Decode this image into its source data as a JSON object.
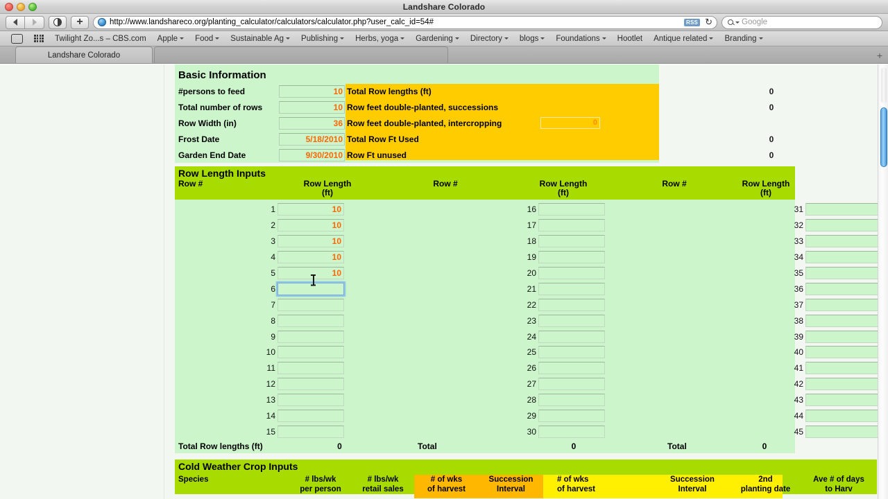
{
  "window": {
    "title": "Landshare Colorado"
  },
  "toolbar": {
    "back_label": "Back",
    "forward_label": "Forward",
    "share_label": "Share",
    "add_label": "+",
    "url": "http://www.landshareco.org/planting_calculator/calculators/calculator.php?user_calc_id=54#",
    "rss_label": "RSS",
    "reload_label": "↻",
    "search_placeholder": "Google"
  },
  "bookmarks": [
    {
      "label": "Twilight Zo...s – CBS.com",
      "menu": false
    },
    {
      "label": "Apple",
      "menu": true
    },
    {
      "label": "Food",
      "menu": true
    },
    {
      "label": "Sustainable Ag",
      "menu": true
    },
    {
      "label": "Publishing",
      "menu": true
    },
    {
      "label": "Herbs, yoga",
      "menu": true
    },
    {
      "label": "Gardening",
      "menu": true
    },
    {
      "label": "Directory",
      "menu": true
    },
    {
      "label": "blogs",
      "menu": true
    },
    {
      "label": "Foundations",
      "menu": true
    },
    {
      "label": "Hootlet",
      "menu": false
    },
    {
      "label": "Antique related",
      "menu": true
    },
    {
      "label": "Branding",
      "menu": true
    }
  ],
  "tabs": {
    "active_label": "Landshare Colorado",
    "inactive_label": "",
    "new_tab_label": "+"
  },
  "basic_information": {
    "title": "Basic Information",
    "fields": [
      {
        "label": "#persons to feed",
        "value": "10"
      },
      {
        "label": "Total number of rows",
        "value": "10"
      },
      {
        "label": "Row Width (in)",
        "value": "36"
      },
      {
        "label": "Frost Date",
        "value": "5/18/2010"
      },
      {
        "label": "Garden End Date",
        "value": "9/30/2010"
      }
    ],
    "summary": [
      {
        "label": "Total Row lengths (ft)",
        "value": "0",
        "input": false
      },
      {
        "label": "Row feet double-planted, successions",
        "value": "0",
        "input": false
      },
      {
        "label": "Row feet double-planted, intercropping",
        "value": "0",
        "input": true
      },
      {
        "label": "Total Row Ft Used",
        "value": "0",
        "input": false
      },
      {
        "label": "Row Ft unused",
        "value": "0",
        "input": false
      }
    ]
  },
  "row_length_inputs": {
    "title": "Row Length Inputs",
    "columns": [
      {
        "header": "Row #",
        "sub": ""
      },
      {
        "header": "Row Length",
        "sub": "(ft)"
      },
      {
        "header": "Row #",
        "sub": ""
      },
      {
        "header": "Row Length",
        "sub": "(ft)"
      },
      {
        "header": "Row #",
        "sub": ""
      },
      {
        "header": "Row Length",
        "sub": "(ft)"
      }
    ],
    "col1": [
      {
        "num": "1",
        "value": "10",
        "focused": false
      },
      {
        "num": "2",
        "value": "10",
        "focused": false
      },
      {
        "num": "3",
        "value": "10",
        "focused": false
      },
      {
        "num": "4",
        "value": "10",
        "focused": false
      },
      {
        "num": "5",
        "value": "10",
        "focused": false
      },
      {
        "num": "6",
        "value": "",
        "focused": true
      },
      {
        "num": "7",
        "value": "",
        "focused": false
      },
      {
        "num": "8",
        "value": "",
        "focused": false
      },
      {
        "num": "9",
        "value": "",
        "focused": false
      },
      {
        "num": "10",
        "value": "",
        "focused": false
      },
      {
        "num": "11",
        "value": "",
        "focused": false
      },
      {
        "num": "12",
        "value": "",
        "focused": false
      },
      {
        "num": "13",
        "value": "",
        "focused": false
      },
      {
        "num": "14",
        "value": "",
        "focused": false
      },
      {
        "num": "15",
        "value": "",
        "focused": false
      }
    ],
    "col2": [
      {
        "num": "16",
        "value": ""
      },
      {
        "num": "17",
        "value": ""
      },
      {
        "num": "18",
        "value": ""
      },
      {
        "num": "19",
        "value": ""
      },
      {
        "num": "20",
        "value": ""
      },
      {
        "num": "21",
        "value": ""
      },
      {
        "num": "22",
        "value": ""
      },
      {
        "num": "23",
        "value": ""
      },
      {
        "num": "24",
        "value": ""
      },
      {
        "num": "25",
        "value": ""
      },
      {
        "num": "26",
        "value": ""
      },
      {
        "num": "27",
        "value": ""
      },
      {
        "num": "28",
        "value": ""
      },
      {
        "num": "29",
        "value": ""
      },
      {
        "num": "30",
        "value": ""
      }
    ],
    "col3": [
      {
        "num": "31",
        "value": ""
      },
      {
        "num": "32",
        "value": ""
      },
      {
        "num": "33",
        "value": ""
      },
      {
        "num": "34",
        "value": ""
      },
      {
        "num": "35",
        "value": ""
      },
      {
        "num": "36",
        "value": ""
      },
      {
        "num": "37",
        "value": ""
      },
      {
        "num": "38",
        "value": ""
      },
      {
        "num": "39",
        "value": ""
      },
      {
        "num": "40",
        "value": ""
      },
      {
        "num": "41",
        "value": ""
      },
      {
        "num": "42",
        "value": ""
      },
      {
        "num": "43",
        "value": ""
      },
      {
        "num": "44",
        "value": ""
      },
      {
        "num": "45",
        "value": ""
      }
    ],
    "totals": {
      "label1": "Total Row lengths (ft)",
      "value1": "0",
      "label2": "Total",
      "value2": "0",
      "label3": "Total",
      "value3": "0"
    }
  },
  "cold_weather_crop_inputs": {
    "title": "Cold Weather Crop Inputs",
    "columns": [
      {
        "line1": "Species",
        "line2": ""
      },
      {
        "line1": "# lbs/wk",
        "line2": "per person"
      },
      {
        "line1": "# lbs/wk",
        "line2": "retail sales"
      },
      {
        "line1": "# of wks",
        "line2": "of harvest"
      },
      {
        "line1": "Succession",
        "line2": "Interval"
      },
      {
        "line1": "# of wks",
        "line2": "of harvest"
      },
      {
        "line1": "Succession",
        "line2": "Interval"
      },
      {
        "line1": "2nd",
        "line2": "planting date"
      },
      {
        "line1": "Ave # of days",
        "line2": "to Harv"
      }
    ]
  },
  "colors": {
    "header_green": "#a8dc00",
    "panel_green": "#ccf5cc",
    "summary_yellow": "#ffcc00",
    "band_orange": "#ffb700",
    "band_yellow": "#ffef00",
    "input_text": "#ff6600"
  }
}
